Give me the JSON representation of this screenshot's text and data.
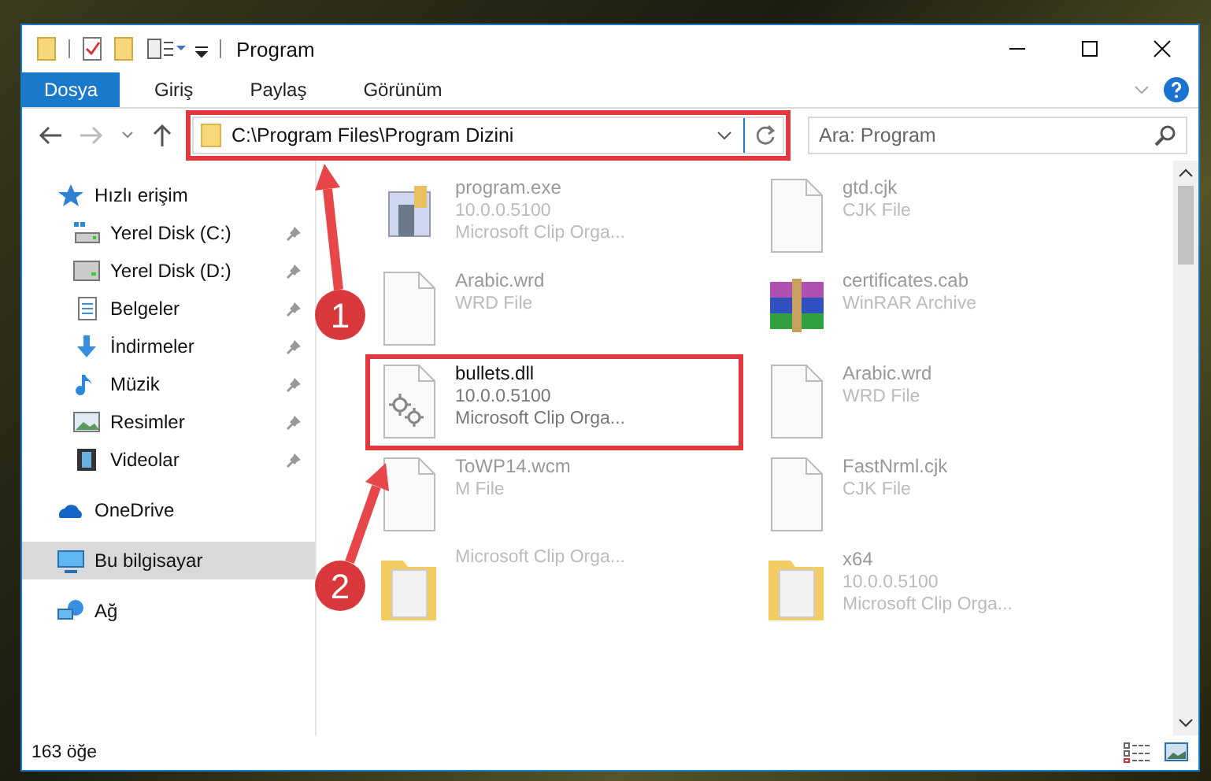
{
  "window": {
    "title": "Program"
  },
  "ribbon_tabs": [
    {
      "label": "Dosya",
      "selected": true
    },
    {
      "label": "Giriş",
      "selected": false
    },
    {
      "label": "Paylaş",
      "selected": false
    },
    {
      "label": "Görünüm",
      "selected": false
    }
  ],
  "address": {
    "path": "C:\\Program Files\\Program Dizini"
  },
  "search": {
    "placeholder": "Ara: Program"
  },
  "sidebar": {
    "items": [
      {
        "label": "Hızlı erişim",
        "kind": "star",
        "selected": false,
        "children": [
          {
            "label": "Yerel Disk (C:)",
            "kind": "disk-c",
            "pinned": true,
            "selected": false
          },
          {
            "label": "Yerel Disk (D:)",
            "kind": "disk",
            "pinned": true,
            "selected": false
          },
          {
            "label": "Belgeler",
            "kind": "docs",
            "pinned": true,
            "selected": false
          },
          {
            "label": "İndirmeler",
            "kind": "download",
            "pinned": true,
            "selected": false
          },
          {
            "label": "Müzik",
            "kind": "music",
            "pinned": true,
            "selected": false
          },
          {
            "label": "Resimler",
            "kind": "pictures",
            "pinned": true,
            "selected": false
          },
          {
            "label": "Videolar",
            "kind": "video",
            "pinned": true,
            "selected": false
          }
        ]
      },
      {
        "label": "OneDrive",
        "kind": "cloud",
        "selected": false
      },
      {
        "label": "Bu bilgisayar",
        "kind": "pc",
        "selected": true
      },
      {
        "label": "Ağ",
        "kind": "network",
        "selected": false
      }
    ]
  },
  "files": [
    {
      "kind": "exe",
      "name": "program.exe",
      "lines": [
        "10.0.0.5100",
        "Microsoft Clip Orga..."
      ],
      "focus": false
    },
    {
      "kind": "doc",
      "name": "gtd.cjk",
      "lines": [
        "CJK File"
      ],
      "focus": false
    },
    {
      "kind": "doc",
      "name": "Arabic.wrd",
      "lines": [
        "WRD File"
      ],
      "focus": false
    },
    {
      "kind": "rar",
      "name": "certificates.cab",
      "lines": [
        "WinRAR Archive"
      ],
      "focus": false
    },
    {
      "kind": "dll",
      "name": "bullets.dll",
      "lines": [
        "10.0.0.5100",
        "Microsoft Clip Orga..."
      ],
      "focus": true
    },
    {
      "kind": "doc",
      "name": "Arabic.wrd",
      "lines": [
        "WRD File"
      ],
      "focus": false
    },
    {
      "kind": "doc",
      "name": "ToWP14.wcm",
      "lines": [
        "M File"
      ],
      "focus": false
    },
    {
      "kind": "doc",
      "name": "FastNrml.cjk",
      "lines": [
        "CJK File"
      ],
      "focus": false
    },
    {
      "kind": "folder",
      "lines": [
        "Microsoft Clip Orga..."
      ],
      "focus": false
    },
    {
      "kind": "folder",
      "name": "x64",
      "lines": [
        "10.0.0.5100",
        "Microsoft Clip Orga..."
      ],
      "focus": false
    }
  ],
  "status_bar": {
    "count": "163 öğe"
  },
  "annotations": [
    {
      "label": "1"
    },
    {
      "label": "2"
    }
  ]
}
